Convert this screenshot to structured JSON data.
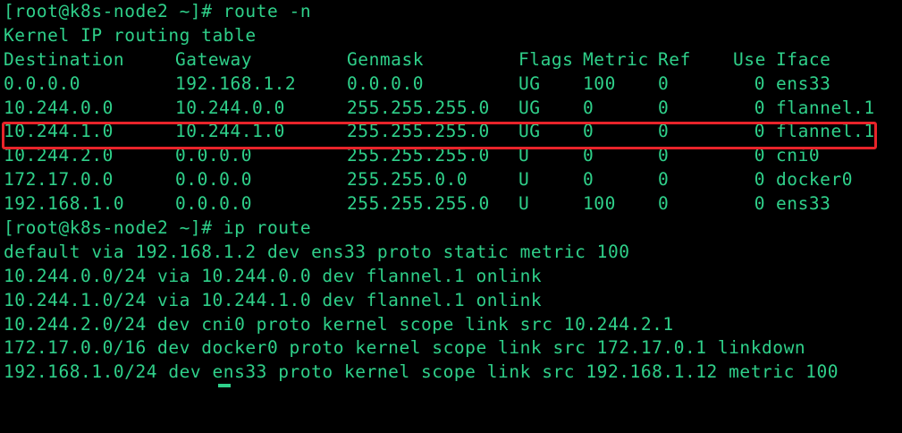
{
  "terminal": {
    "text_color": "#2fd08a",
    "background_color": "#000000",
    "highlight_color": "#e8242a",
    "prompt1": "[root@k8s-node2 ~]# route -n",
    "table_title": "Kernel IP routing table",
    "route_table": {
      "headers": {
        "destination": "Destination",
        "gateway": "Gateway",
        "genmask": "Genmask",
        "flags": "Flags",
        "metric": "Metric",
        "ref": "Ref",
        "use": "Use",
        "iface": "Iface"
      },
      "rows": [
        {
          "destination": "0.0.0.0",
          "gateway": "192.168.1.2",
          "genmask": "0.0.0.0",
          "flags": "UG",
          "metric": "100",
          "ref": "0",
          "use": "0",
          "iface": "ens33"
        },
        {
          "destination": "10.244.0.0",
          "gateway": "10.244.0.0",
          "genmask": "255.255.255.0",
          "flags": "UG",
          "metric": "0",
          "ref": "0",
          "use": "0",
          "iface": "flannel.1"
        },
        {
          "destination": "10.244.1.0",
          "gateway": "10.244.1.0",
          "genmask": "255.255.255.0",
          "flags": "UG",
          "metric": "0",
          "ref": "0",
          "use": "0",
          "iface": "flannel.1"
        },
        {
          "destination": "10.244.2.0",
          "gateway": "0.0.0.0",
          "genmask": "255.255.255.0",
          "flags": "U",
          "metric": "0",
          "ref": "0",
          "use": "0",
          "iface": "cni0"
        },
        {
          "destination": "172.17.0.0",
          "gateway": "0.0.0.0",
          "genmask": "255.255.0.0",
          "flags": "U",
          "metric": "0",
          "ref": "0",
          "use": "0",
          "iface": "docker0"
        },
        {
          "destination": "192.168.1.0",
          "gateway": "0.0.0.0",
          "genmask": "255.255.255.0",
          "flags": "U",
          "metric": "100",
          "ref": "0",
          "use": "0",
          "iface": "ens33"
        }
      ]
    },
    "prompt2": "[root@k8s-node2 ~]# ip route",
    "ip_route_lines": [
      "default via 192.168.1.2 dev ens33 proto static metric 100",
      "10.244.0.0/24 via 10.244.0.0 dev flannel.1 onlink",
      "10.244.1.0/24 via 10.244.1.0 dev flannel.1 onlink",
      "10.244.2.0/24 dev cni0 proto kernel scope link src 10.244.2.1",
      "172.17.0.0/16 dev docker0 proto kernel scope link src 172.17.0.1 linkdown",
      "192.168.1.0/24 dev ens33 proto kernel scope link src 192.168.1.12 metric 100"
    ]
  }
}
